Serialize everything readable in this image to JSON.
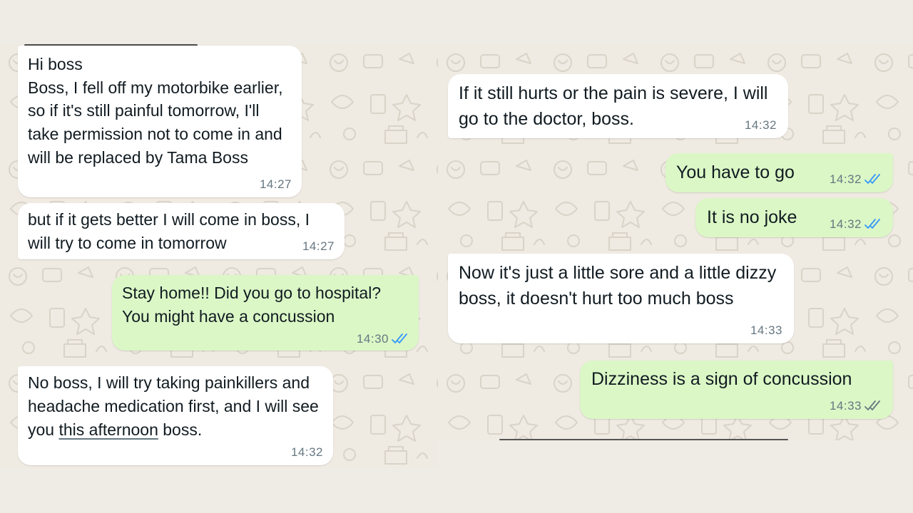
{
  "colors": {
    "incoming_bubble": "#ffffff",
    "outgoing_bubble": "#dbf7c6",
    "wallpaper": "#efeae2",
    "timestamp": "#667781",
    "read_ticks": "#3497f9",
    "delivered_ticks": "#667781"
  },
  "left_panel": {
    "messages": [
      {
        "direction": "incoming",
        "text": "Hi boss\nBoss, I fell off my motorbike earlier, so if it's still painful tomorrow, I'll take permission not to come in and will be replaced by Tama Boss",
        "time": "14:27"
      },
      {
        "direction": "incoming",
        "text": "but if it gets better I will come in boss, I will try to come in tomorrow",
        "time": "14:27"
      },
      {
        "direction": "outgoing",
        "text": "Stay home!! Did you go to hospital? You might have a concussion",
        "time": "14:30",
        "status": "read",
        "icon": "double-check-icon"
      },
      {
        "direction": "incoming",
        "text_before": "No boss, I will try taking painkillers and headache medication first, and I will see you ",
        "text_underlined": "this afternoon",
        "text_after": " boss.",
        "time": "14:32"
      }
    ]
  },
  "right_panel": {
    "messages": [
      {
        "direction": "incoming",
        "text": "If it still hurts or the pain is severe, I will go to the doctor, boss.",
        "time": "14:32"
      },
      {
        "direction": "outgoing",
        "text": "You have to go",
        "time": "14:32",
        "status": "read",
        "icon": "double-check-icon"
      },
      {
        "direction": "outgoing",
        "text": "It is no joke",
        "time": "14:32",
        "status": "read",
        "icon": "double-check-icon"
      },
      {
        "direction": "incoming",
        "text": "Now it's just a little sore and a little dizzy boss, it doesn't hurt too much boss",
        "time": "14:33"
      },
      {
        "direction": "outgoing",
        "text": "Dizziness is a sign of concussion",
        "time": "14:33",
        "status": "delivered",
        "icon": "double-check-icon"
      }
    ]
  }
}
